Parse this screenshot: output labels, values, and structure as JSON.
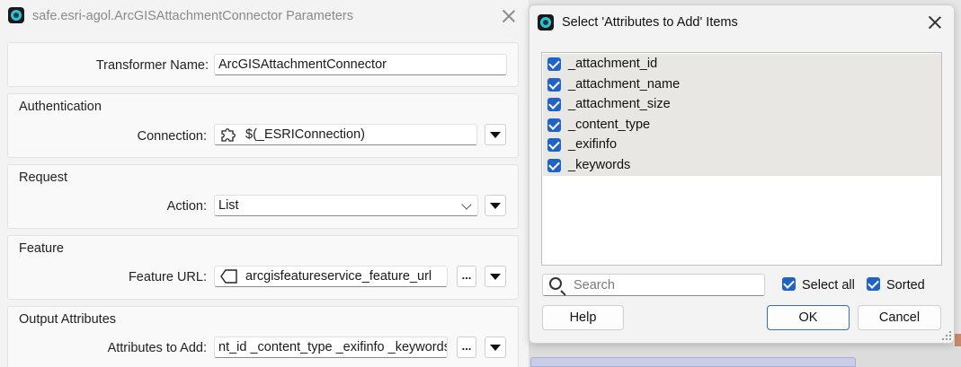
{
  "left_window": {
    "title": "safe.esri-agol.ArcGISAttachmentConnector Parameters",
    "transformer_name_label": "Transformer Name:",
    "transformer_name_value": "ArcGISAttachmentConnector",
    "groups": {
      "authentication": {
        "title": "Authentication",
        "connection_label": "Connection:",
        "connection_value": "$(_ESRIConnection)"
      },
      "request": {
        "title": "Request",
        "action_label": "Action:",
        "action_value": "List"
      },
      "feature": {
        "title": "Feature",
        "feature_url_label": "Feature URL:",
        "feature_url_value": "arcgisfeatureservice_feature_url",
        "ellipsis_label": "..."
      },
      "output_attributes": {
        "title": "Output Attributes",
        "attributes_label": "Attributes to Add:",
        "attributes_value": "nt_id _content_type _exifinfo _keywords",
        "ellipsis_label": "..."
      }
    }
  },
  "dialog": {
    "title": "Select 'Attributes to Add' Items",
    "items": [
      {
        "label": "_attachment_id",
        "checked": true
      },
      {
        "label": "_attachment_name",
        "checked": true
      },
      {
        "label": "_attachment_size",
        "checked": true
      },
      {
        "label": "_content_type",
        "checked": true
      },
      {
        "label": "_exifinfo",
        "checked": true
      },
      {
        "label": "_keywords",
        "checked": true
      }
    ],
    "search_placeholder": "Search",
    "select_all_label": "Select all",
    "sorted_label": "Sorted",
    "help_label": "Help",
    "ok_label": "OK",
    "cancel_label": "Cancel"
  },
  "colors": {
    "accent": "#1f63c6",
    "app_icon": "#2ec4d6"
  }
}
